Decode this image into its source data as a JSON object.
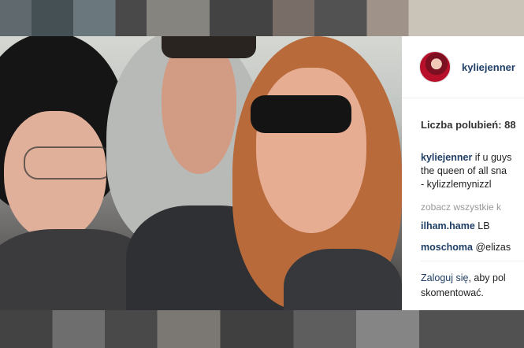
{
  "post": {
    "username": "kyliejenner",
    "likes_label": "Liczba polubień: 88",
    "caption_user": "kyliejenner",
    "caption_text_1": " if u guys",
    "caption_text_2": "the queen of all sna",
    "caption_text_3": "- kylizzlemynizzl",
    "see_all_comments": "zobacz wszystkie k",
    "comments": [
      {
        "user": "ilham.hame",
        "text": " LB"
      },
      {
        "user": "moschoma",
        "text": " @elizas"
      }
    ],
    "login_link": "Zaloguj się",
    "login_text_1": ", aby pol",
    "login_text_2": "skomentować."
  },
  "colors": {
    "username": "#1f3f66",
    "muted": "#999999"
  }
}
